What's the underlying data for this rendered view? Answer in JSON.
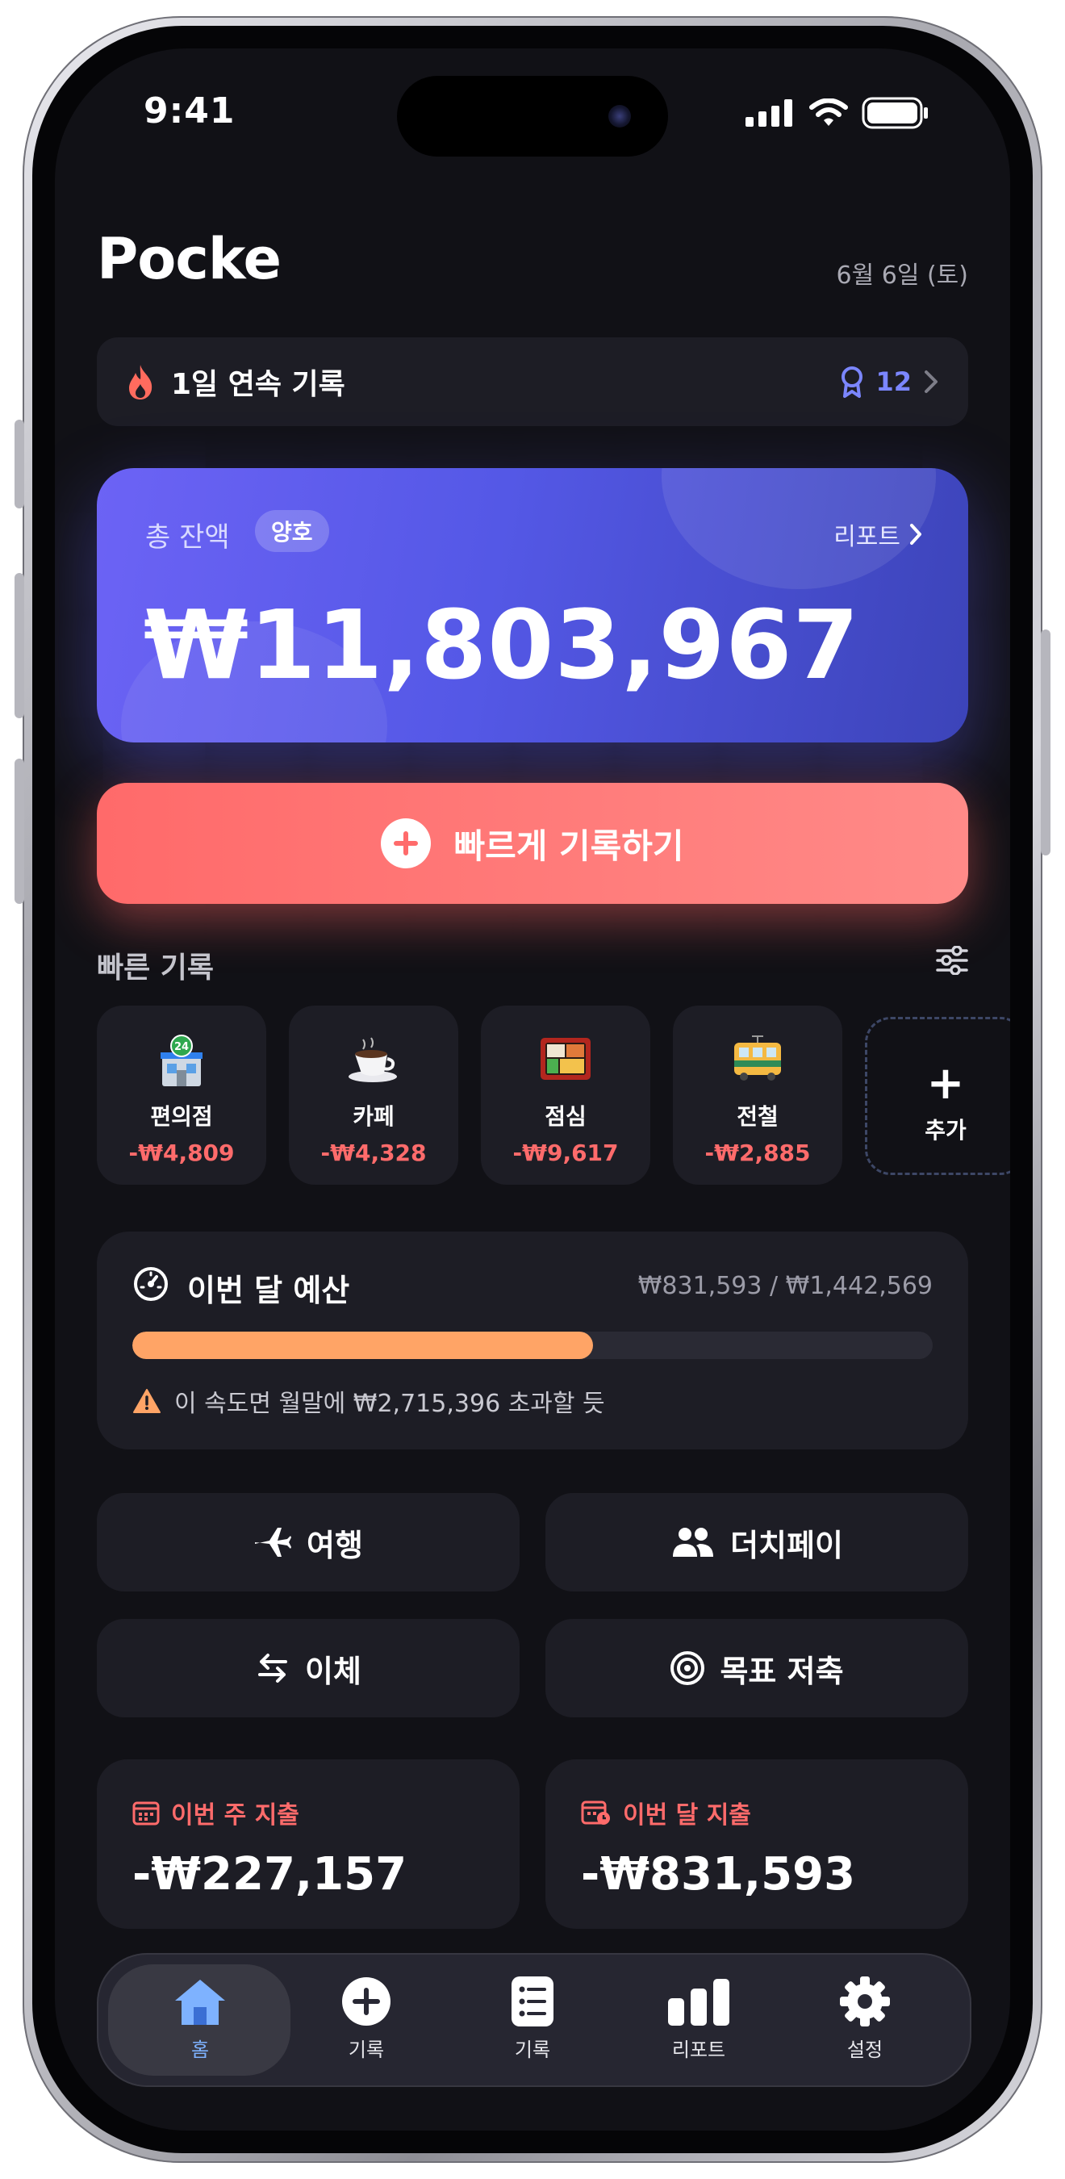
{
  "status_bar": {
    "time": "9:41"
  },
  "header": {
    "brand": "Pocke",
    "date": "6월 6일 (토)"
  },
  "streak": {
    "label": "1일 연속 기록",
    "badge_count": "12"
  },
  "balance_card": {
    "label": "총 잔액",
    "status_badge": "양호",
    "report_link": "리포트",
    "amount": "₩11,803,967"
  },
  "quick_record_button": {
    "label": "빠르게 기록하기"
  },
  "quick_section": {
    "title": "빠른 기록",
    "items": [
      {
        "name": "편의점",
        "price": "-₩4,809",
        "icon": "convenience-store-icon"
      },
      {
        "name": "카페",
        "price": "-₩4,328",
        "icon": "coffee-icon"
      },
      {
        "name": "점심",
        "price": "-₩9,617",
        "icon": "bento-icon"
      },
      {
        "name": "전철",
        "price": "-₩2,885",
        "icon": "tram-icon"
      }
    ],
    "add_label": "추가"
  },
  "budget": {
    "title": "이번 달 예산",
    "value": "₩831,593 / ₩1,442,569",
    "progress": 0.576,
    "warning": "이 속도면 월말에 ₩2,715,396 초과할 듯"
  },
  "actions": [
    {
      "label": "여행",
      "icon": "airplane-icon"
    },
    {
      "label": "더치페이",
      "icon": "people-icon"
    },
    {
      "label": "이체",
      "icon": "transfer-icon"
    },
    {
      "label": "목표 저축",
      "icon": "target-icon"
    }
  ],
  "spending": {
    "week": {
      "label": "이번 주 지출",
      "amount": "-₩227,157"
    },
    "month": {
      "label": "이번 달 지출",
      "amount": "-₩831,593"
    }
  },
  "tabs": [
    {
      "label": "홈",
      "icon": "home-icon",
      "active": true
    },
    {
      "label": "기록",
      "icon": "plus-circle-icon"
    },
    {
      "label": "기록",
      "icon": "list-icon"
    },
    {
      "label": "리포트",
      "icon": "bar-chart-icon"
    },
    {
      "label": "설정",
      "icon": "gear-icon"
    }
  ],
  "colors": {
    "background": "#111116",
    "card": "#1d1d25",
    "accent_red": "#ff6b6b",
    "accent_blue": "#7b86ff",
    "progress_orange": "#ffa466"
  }
}
